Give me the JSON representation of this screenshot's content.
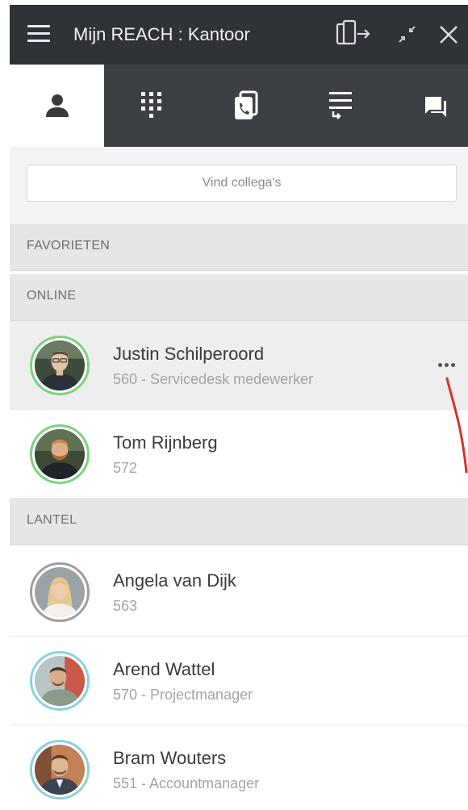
{
  "window": {
    "title": "Mijn REACH : Kantoor",
    "menu_icon": "hamburger-menu-icon",
    "controls": [
      "popout-icon",
      "minimize-icon",
      "close-icon"
    ]
  },
  "tabs": [
    {
      "id": "contacts",
      "icon": "person-icon",
      "active": true
    },
    {
      "id": "dialpad",
      "icon": "dialpad-icon",
      "active": false
    },
    {
      "id": "calls",
      "icon": "call-log-icon",
      "active": false
    },
    {
      "id": "queues",
      "icon": "queue-list-icon",
      "active": false
    },
    {
      "id": "chat",
      "icon": "chat-icon",
      "active": false
    }
  ],
  "search": {
    "placeholder": "Vind collega's"
  },
  "sections": {
    "favorites": "FAVORIETEN",
    "online": "ONLINE",
    "lantel": "LANTEL"
  },
  "contacts": [
    {
      "name": "Justin Schilperoord",
      "detail": "560 - Servicedesk medewerker",
      "group": "ONLINE",
      "status_color": "#7bd37e",
      "selected": true
    },
    {
      "name": "Tom Rijnberg",
      "detail": "572",
      "group": "ONLINE",
      "status_color": "#7bd37e",
      "selected": false
    },
    {
      "name": "Angela van Dijk",
      "detail": "563",
      "group": "LANTEL",
      "status_color": "#9e9e9e",
      "selected": false
    },
    {
      "name": "Arend Wattel",
      "detail": "570 - Projectmanager",
      "group": "LANTEL",
      "status_color": "#8ad3dc",
      "selected": false
    },
    {
      "name": "Bram Wouters",
      "detail": "551 - Accountmanager",
      "group": "LANTEL",
      "status_color": "#8ad3dc",
      "selected": false
    }
  ],
  "colors": {
    "titlebar": "#2f3236",
    "tabbar": "#3c3f44",
    "online_ring": "#7bd37e",
    "offline_ring": "#9e9e9e",
    "away_ring": "#8ad3dc",
    "annotation": "#d9312a"
  }
}
